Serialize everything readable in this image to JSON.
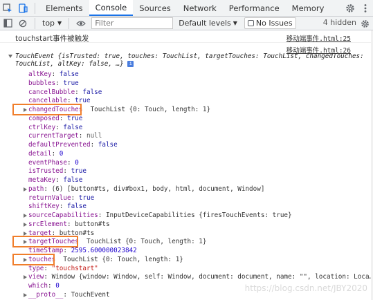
{
  "tabs": [
    {
      "label": "Elements"
    },
    {
      "label": "Console"
    },
    {
      "label": "Sources"
    },
    {
      "label": "Network"
    },
    {
      "label": "Performance"
    },
    {
      "label": "Memory"
    }
  ],
  "toolbar": {
    "context": "top",
    "filter_placeholder": "Filter",
    "levels_label": "Default levels",
    "issues_label": "No Issues",
    "hidden_label": "4 hidden"
  },
  "log": {
    "message": "touchstart事件被触发",
    "source1": "移动端事件.html:25",
    "source2": "移动端事件.html:26"
  },
  "event": {
    "head": "TouchEvent {isTrusted: true, touches: TouchList, targetTouches: TouchList, changedTouches:",
    "head2": "TouchList, altKey: false, …}",
    "info_badge": "i",
    "props": [
      {
        "key": "altKey",
        "value": "false",
        "type": "bool"
      },
      {
        "key": "bubbles",
        "value": "true",
        "type": "bool"
      },
      {
        "key": "cancelBubble",
        "value": "false",
        "type": "bool"
      },
      {
        "key": "cancelable",
        "value": "true",
        "type": "bool"
      },
      {
        "key": "changedTouches",
        "value": "TouchList {0: Touch, length: 1}",
        "type": "obj",
        "expandable": true,
        "highlight": true
      },
      {
        "key": "composed",
        "value": "true",
        "type": "bool"
      },
      {
        "key": "ctrlKey",
        "value": "false",
        "type": "bool"
      },
      {
        "key": "currentTarget",
        "value": "null",
        "type": "null"
      },
      {
        "key": "defaultPrevented",
        "value": "false",
        "type": "bool"
      },
      {
        "key": "detail",
        "value": "0",
        "type": "num"
      },
      {
        "key": "eventPhase",
        "value": "0",
        "type": "num"
      },
      {
        "key": "isTrusted",
        "value": "true",
        "type": "bool"
      },
      {
        "key": "metaKey",
        "value": "false",
        "type": "bool"
      },
      {
        "key": "path",
        "value": "(6) [button#ts, div#box1, body, html, document, Window]",
        "type": "obj",
        "expandable": true
      },
      {
        "key": "returnValue",
        "value": "true",
        "type": "bool"
      },
      {
        "key": "shiftKey",
        "value": "false",
        "type": "bool"
      },
      {
        "key": "sourceCapabilities",
        "value": "InputDeviceCapabilities {firesTouchEvents: true}",
        "type": "obj",
        "expandable": true
      },
      {
        "key": "srcElement",
        "value": "button#ts",
        "type": "obj",
        "expandable": true
      },
      {
        "key": "target",
        "value": "button#ts",
        "type": "obj",
        "expandable": true
      },
      {
        "key": "targetTouches",
        "value": "TouchList {0: Touch, length: 1}",
        "type": "obj",
        "expandable": true,
        "highlight": true
      },
      {
        "key": "timeStamp",
        "value": "2595.600000023842",
        "type": "num"
      },
      {
        "key": "touches",
        "value": "TouchList {0: Touch, length: 1}",
        "type": "obj",
        "expandable": true,
        "highlight": true
      },
      {
        "key": "type",
        "value": "\"touchstart\"",
        "type": "str"
      },
      {
        "key": "view",
        "value": "Window {window: Window, self: Window, document: document, name: \"\", location: Loca…",
        "type": "obj",
        "expandable": true
      },
      {
        "key": "which",
        "value": "0",
        "type": "num"
      },
      {
        "key": "__proto__",
        "value": "TouchEvent",
        "type": "obj",
        "expandable": true
      }
    ]
  },
  "watermark": "https://blog.csdn.net/JBY2020",
  "colors": {
    "accent": "#1a73e8",
    "highlight_box": "#f07e2b",
    "key": "#881391",
    "bool": "#1a1aa6",
    "num": "#1c00cf",
    "str": "#c41a16"
  }
}
